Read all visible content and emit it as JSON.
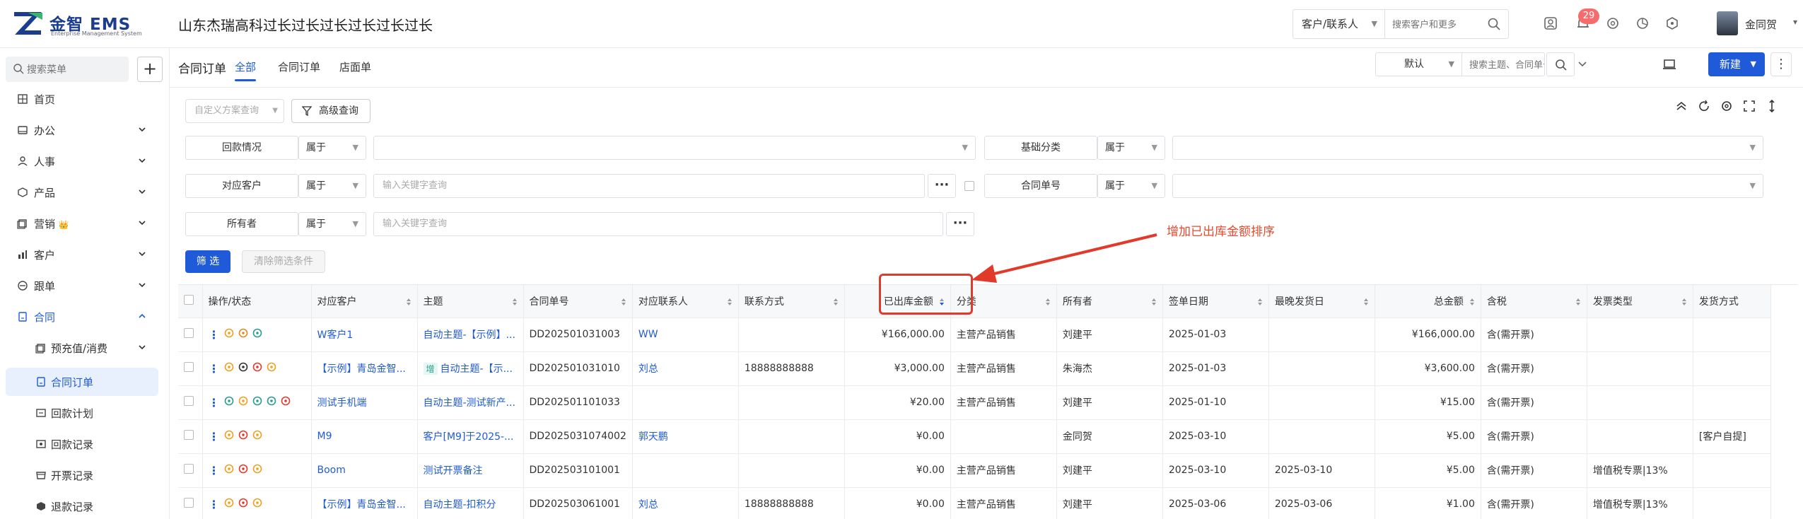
{
  "app": {
    "brand": "金智 EMS",
    "subtitle": "Enterprise Management System",
    "company": "山东杰瑞高科过长过长过长过长过长过长"
  },
  "header": {
    "search_type": "客户/联系人",
    "search_placeholder": "搜索客户和更多",
    "badge_count": "29",
    "user_name": "金同贺"
  },
  "sidebar": {
    "search_placeholder": "搜索菜单",
    "items": [
      {
        "label": "首页",
        "icon": "home-icon"
      },
      {
        "label": "办公",
        "icon": "office-icon"
      },
      {
        "label": "人事",
        "icon": "people-icon"
      },
      {
        "label": "产品",
        "icon": "box-icon"
      },
      {
        "label": "营销",
        "icon": "marketing-icon",
        "extra": "👑"
      },
      {
        "label": "客户",
        "icon": "customer-icon"
      },
      {
        "label": "跟单",
        "icon": "follow-icon"
      },
      {
        "label": "合同",
        "icon": "contract-icon"
      }
    ],
    "subitems": [
      {
        "label": "预充值/消费"
      },
      {
        "label": "合同订单"
      },
      {
        "label": "回款计划"
      },
      {
        "label": "回款记录"
      },
      {
        "label": "开票记录"
      },
      {
        "label": "退款记录"
      }
    ]
  },
  "tabs": {
    "page_title": "合同订单",
    "items": [
      "全部",
      "合同订单",
      "店面单"
    ]
  },
  "toolbar": {
    "view": "默认",
    "search_placeholder": "搜索主题、合同单号...",
    "new_label": "新建"
  },
  "filters": {
    "scheme_placeholder": "自定义方案查询",
    "advanced": "高级查询",
    "rows": [
      {
        "label": "回款情况",
        "op": "属于",
        "label2": "基础分类",
        "op2": "属于"
      },
      {
        "label": "对应客户",
        "op": "属于",
        "placeholder": "输入关键字查询",
        "label2": "合同单号",
        "op2": "属于"
      },
      {
        "label": "所有者",
        "op": "属于",
        "placeholder": "输入关键字查询"
      }
    ],
    "filter_btn": "筛 选",
    "clear_btn": "清除筛选条件"
  },
  "annotation": "增加已出库金额排序",
  "table": {
    "columns": [
      "操作/状态",
      "对应客户",
      "主题",
      "合同单号",
      "对应联系人",
      "联系方式",
      "已出库金额",
      "分类",
      "所有者",
      "签单日期",
      "最晚发货日",
      "总金额",
      "含税",
      "发票类型",
      "发货方式"
    ],
    "rows": [
      {
        "customer": "W客户1",
        "subject": "自动主题-【示例】...",
        "no": "DD202501031003",
        "contact": "WW",
        "phone": "",
        "shipped": "¥166,000.00",
        "category": "主营产品销售",
        "owner": "刘建平",
        "date": "2025-01-03",
        "latest": "",
        "total": "¥166,000.00",
        "tax": "含(需开票)",
        "invoice": "",
        "ship": ""
      },
      {
        "customer": "【示例】青岛金智...",
        "tag": "增",
        "subject": "自动主题-【示...",
        "no": "DD202501031010",
        "contact": "刘总",
        "phone": "18888888888",
        "shipped": "¥3,000.00",
        "category": "主营产品销售",
        "owner": "朱海杰",
        "date": "2025-01-03",
        "latest": "",
        "total": "¥3,600.00",
        "tax": "含(需开票)",
        "invoice": "",
        "ship": ""
      },
      {
        "customer": "测试手机端",
        "subject": "自动主题-测试新产...",
        "no": "DD202501101033",
        "contact": "",
        "phone": "",
        "shipped": "¥20.00",
        "category": "主营产品销售",
        "owner": "刘建平",
        "date": "2025-01-10",
        "latest": "",
        "total": "¥15.00",
        "tax": "含(需开票)",
        "invoice": "",
        "ship": ""
      },
      {
        "customer": "M9",
        "subject": "客户[M9]于2025-...",
        "no": "DD2025031074002",
        "contact": "郭天鹏",
        "phone": "",
        "shipped": "¥0.00",
        "category": "",
        "owner": "金同贺",
        "date": "2025-03-10",
        "latest": "",
        "total": "¥5.00",
        "tax": "含(需开票)",
        "invoice": "",
        "ship": "[客户自提]"
      },
      {
        "customer": "Boom",
        "subject": "测试开票备注",
        "no": "DD202503101001",
        "contact": "",
        "phone": "",
        "shipped": "¥0.00",
        "category": "主营产品销售",
        "owner": "刘建平",
        "date": "2025-03-10",
        "latest": "2025-03-10",
        "total": "¥5.00",
        "tax": "含(需开票)",
        "invoice": "增值税专票|13%",
        "ship": ""
      },
      {
        "customer": "【示例】青岛金智...",
        "subject": "自动主题-扣积分",
        "no": "DD202503061001",
        "contact": "刘总",
        "phone": "18888888888",
        "shipped": "¥0.00",
        "category": "主营产品销售",
        "owner": "刘建平",
        "date": "2025-03-06",
        "latest": "2025-03-06",
        "total": "¥1.00",
        "tax": "含(需开票)",
        "invoice": "增值税专票|13%",
        "ship": ""
      }
    ]
  },
  "colors": {
    "primary": "#1f5bd8",
    "danger": "#e23a2a"
  }
}
